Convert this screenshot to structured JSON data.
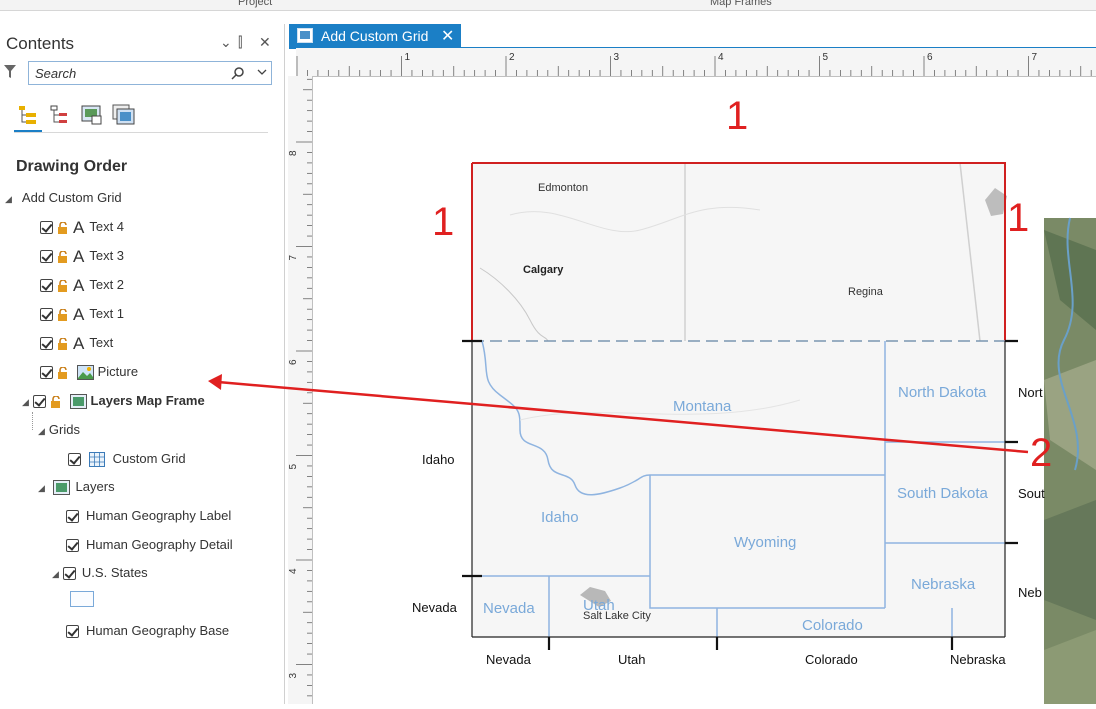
{
  "ribbon": {
    "groups": [
      "Project",
      "Map Frames"
    ]
  },
  "contents": {
    "title": "Contents",
    "controls": [
      "⌄",
      "⫿",
      "✕"
    ],
    "search_placeholder": "Search",
    "section_title": "Drawing Order",
    "root": "Add Custom Grid",
    "text_layers": [
      "Text 4",
      "Text 3",
      "Text 2",
      "Text 1",
      "Text"
    ],
    "picture": "Picture",
    "map_frame": "Layers Map Frame",
    "grids": "Grids",
    "custom_grid": "Custom Grid",
    "layers": "Layers",
    "human_label": "Human Geography Label",
    "human_detail": "Human Geography Detail",
    "us_states": "U.S. States",
    "human_base": "Human Geography Base"
  },
  "tab": {
    "label": "Add Custom Grid",
    "close": "✕"
  },
  "ruler": {
    "h_numbers": [
      "1",
      "2",
      "3",
      "4",
      "5",
      "6",
      "7"
    ],
    "v_numbers": [
      "8",
      "7",
      "6",
      "5",
      "4",
      "3"
    ]
  },
  "map": {
    "annotations": {
      "one": "1",
      "two": "2"
    },
    "cities": {
      "edmonton": "Edmonton",
      "calgary": "Calgary",
      "regina": "Regina",
      "salt_lake": "Salt Lake City"
    },
    "states": {
      "montana": "Montana",
      "idaho": "Idaho",
      "wyoming": "Wyoming",
      "north_dakota": "North Dakota",
      "south_dakota": "South Dakota",
      "nebraska": "Nebraska",
      "nevada": "Nevada",
      "utah": "Utah",
      "colorado": "Colorado"
    },
    "grid_labels": {
      "left_idaho": "Idaho",
      "left_nevada": "Nevada",
      "bottom_nevada": "Nevada",
      "bottom_utah": "Utah",
      "bottom_colorado": "Colorado",
      "bottom_nebraska": "Nebraska",
      "right_north": "Nort",
      "right_south": "Sout",
      "right_neb": "Neb"
    }
  },
  "colors": {
    "accent": "#1b7fc6",
    "annotation_red": "#e02020",
    "state_blue": "#7aa9d9"
  }
}
